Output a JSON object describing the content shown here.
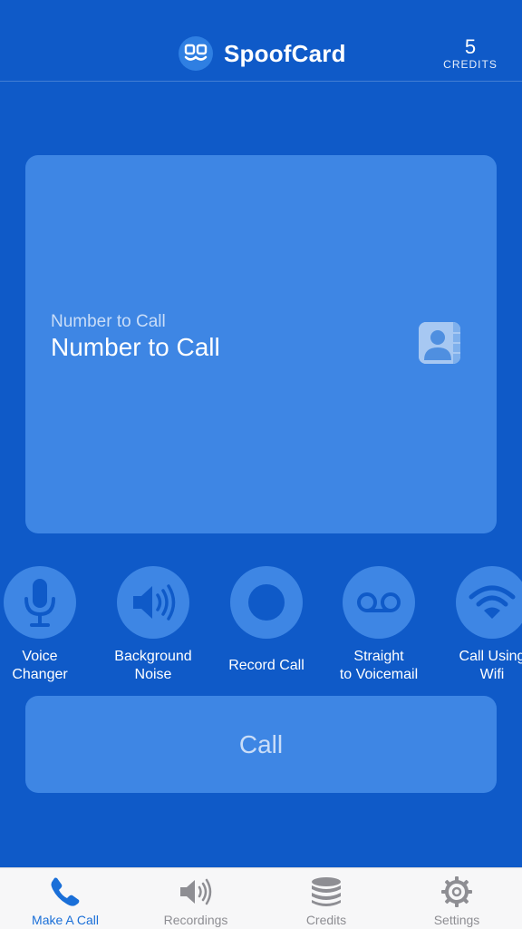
{
  "header": {
    "brand_name": "SpoofCard",
    "credits_count": "5",
    "credits_label": "CREDITS"
  },
  "number_card": {
    "field_label": "Number to Call",
    "field_placeholder": "Number to Call"
  },
  "options": [
    {
      "label": "Voice\nChanger",
      "icon": "microphone-icon"
    },
    {
      "label": "Background\nNoise",
      "icon": "speaker-icon"
    },
    {
      "label": "Record Call",
      "icon": "record-icon"
    },
    {
      "label": "Straight\nto Voicemail",
      "icon": "voicemail-icon"
    },
    {
      "label": "Call Using\nWifi",
      "icon": "wifi-icon"
    }
  ],
  "call_button": {
    "label": "Call"
  },
  "tabbar": {
    "items": [
      {
        "label": "Make A Call",
        "icon": "phone-icon",
        "active": true
      },
      {
        "label": "Recordings",
        "icon": "speaker-icon",
        "active": false
      },
      {
        "label": "Credits",
        "icon": "coins-icon",
        "active": false
      },
      {
        "label": "Settings",
        "icon": "gear-icon",
        "active": false
      }
    ]
  },
  "colors": {
    "background": "#0f5ac8",
    "card": "#3e86e4",
    "active_tab": "#1a6fd8",
    "inactive_tab": "#8e8e93"
  }
}
